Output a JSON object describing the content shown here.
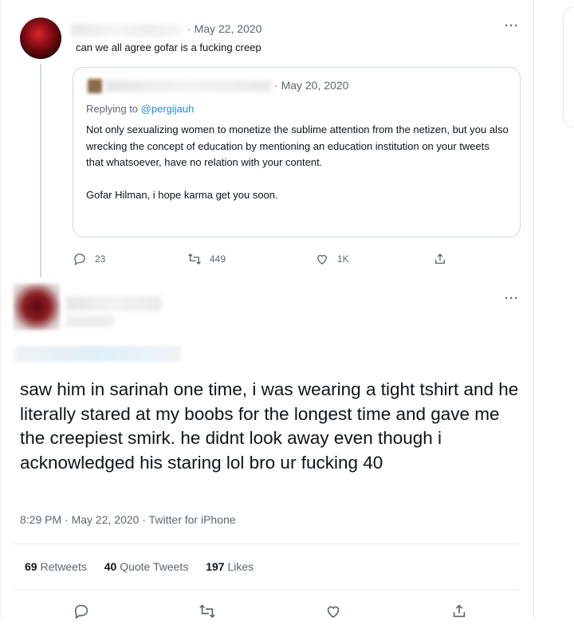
{
  "quoted_tweet": {
    "date": "May 22, 2020",
    "text": "can we all agree gofar is a fucking creep",
    "more": "···",
    "quote": {
      "date": "May 20, 2020",
      "replying_prefix": "Replying to ",
      "replying_handle": "@pergijauh",
      "paragraph1": "Not only sexualizing women to monetize the sublime attention from the netizen, but you also wrecking the concept of education by mentioning an education institution on your tweets that whatsoever, have no relation with your content.",
      "paragraph2": "Gofar Hilman, i hope karma get you soon."
    },
    "actions": {
      "replies": "23",
      "retweets": "449",
      "likes": "1K"
    }
  },
  "main_tweet": {
    "more": "···",
    "text": "saw him in sarinah one time, i was wearing a tight tshirt and he literally stared at my boobs for the longest time and gave me the creepiest smirk. he didnt look away even though i acknowledged his staring lol bro ur fucking 40",
    "time": "8:29 PM",
    "date": "May 22, 2020",
    "source": "Twitter for iPhone",
    "stats": {
      "retweets_count": "69",
      "retweets_label": "Retweets",
      "quotes_count": "40",
      "quotes_label": "Quote Tweets",
      "likes_count": "197",
      "likes_label": "Likes"
    }
  },
  "icons": [
    "reply-icon",
    "retweet-icon",
    "like-icon",
    "share-icon",
    "more-icon"
  ],
  "colors": {
    "link": "#1d8bd8",
    "muted": "#5b6670",
    "border": "#cfd9de"
  }
}
